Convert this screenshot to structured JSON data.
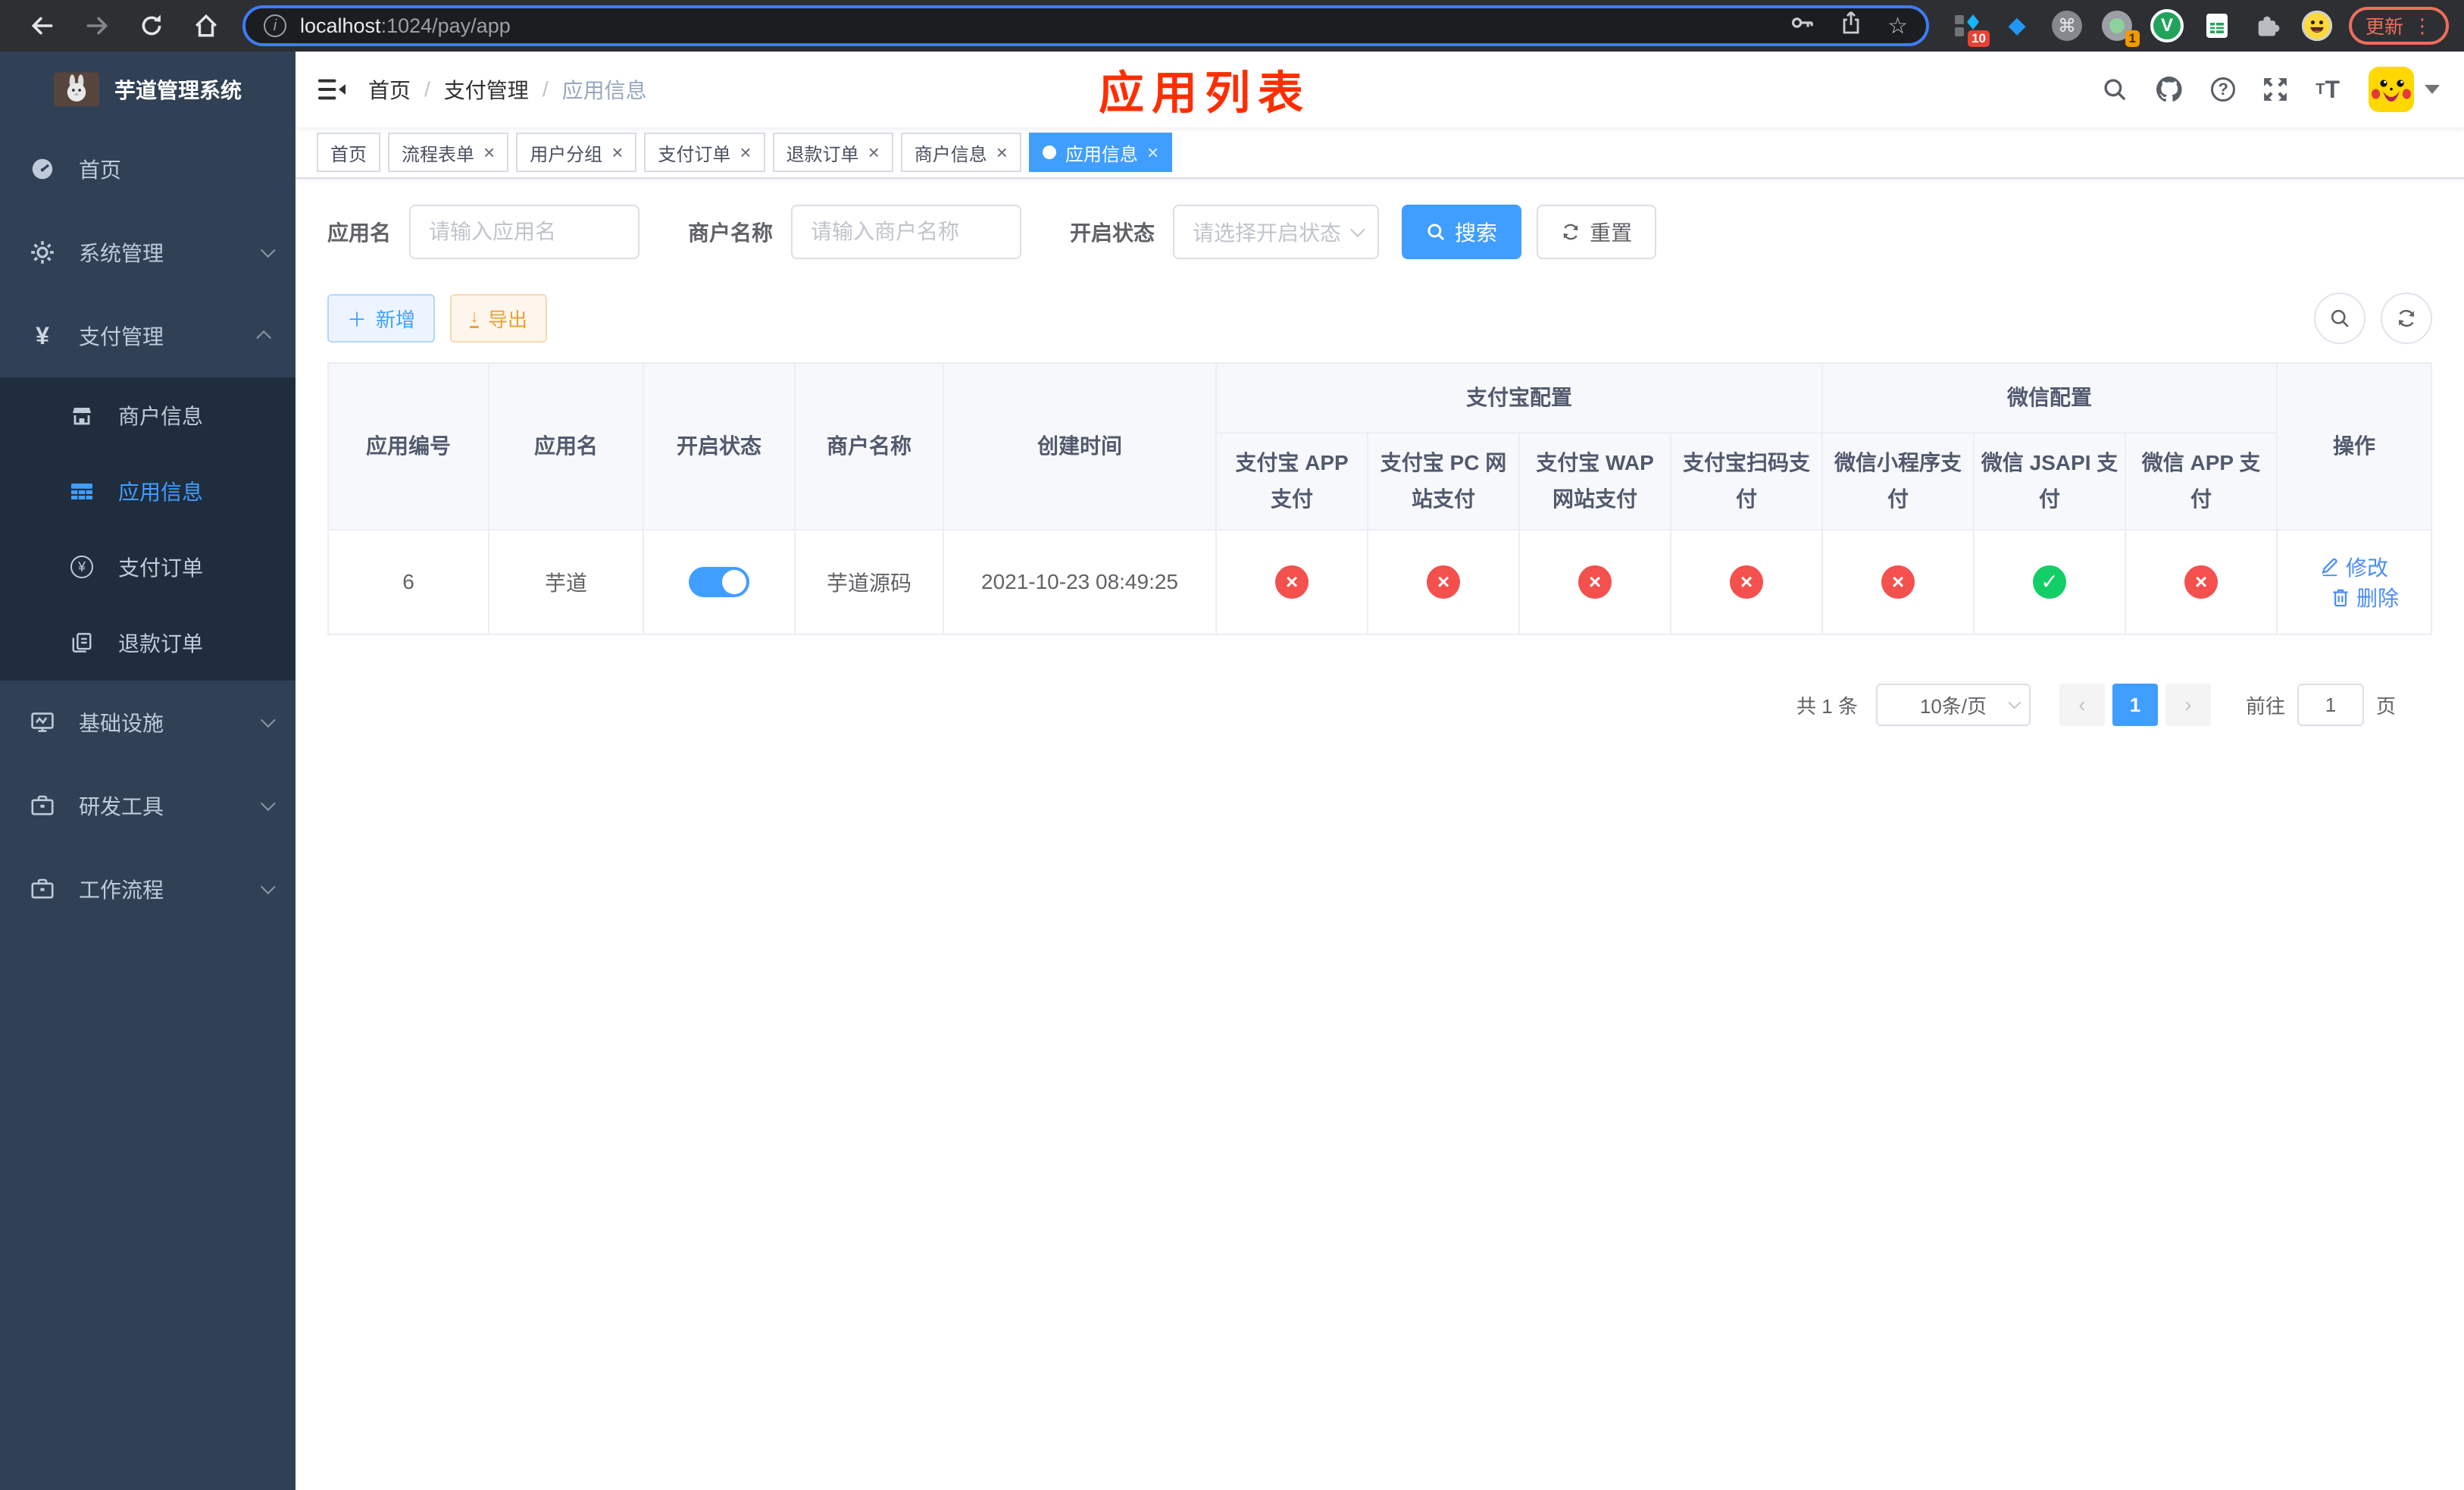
{
  "browser": {
    "url_host": "localhost",
    "url_path": ":1024/pay/app",
    "update_label": "更新",
    "ext_badge_ten": "10",
    "ext_badge_one": "1",
    "ext_v_letter": "V"
  },
  "sidebar": {
    "app_title": "芋道管理系统",
    "items": {
      "home": "首页",
      "system": "系统管理",
      "pay": "支付管理",
      "merchant": "商户信息",
      "app": "应用信息",
      "order": "支付订单",
      "refund": "退款订单",
      "infra": "基础设施",
      "devtools": "研发工具",
      "workflow": "工作流程"
    }
  },
  "navbar": {
    "breadcrumb": [
      "首页",
      "支付管理",
      "应用信息"
    ],
    "breadcrumb_separator": "/",
    "page_title": "应用列表"
  },
  "tabs": [
    {
      "label": "首页"
    },
    {
      "label": "流程表单"
    },
    {
      "label": "用户分组"
    },
    {
      "label": "支付订单"
    },
    {
      "label": "退款订单"
    },
    {
      "label": "商户信息"
    },
    {
      "label": "应用信息",
      "active": true
    }
  ],
  "filters": {
    "app_name_label": "应用名",
    "app_name_placeholder": "请输入应用名",
    "merchant_label": "商户名称",
    "merchant_placeholder": "请输入商户名称",
    "status_label": "开启状态",
    "status_placeholder": "请选择开启状态",
    "search_label": "搜索",
    "reset_label": "重置"
  },
  "toolbar": {
    "add_label": "新增",
    "export_label": "导出"
  },
  "table": {
    "columns": {
      "id": "应用编号",
      "name": "应用名",
      "status": "开启状态",
      "merchant": "商户名称",
      "created": "创建时间",
      "actions": "操作"
    },
    "groups": {
      "alipay": "支付宝配置",
      "wechat": "微信配置"
    },
    "pay_columns": [
      "支付宝 APP 支付",
      "支付宝 PC 网站支付",
      "支付宝 WAP 网站支付",
      "支付宝扫码支付",
      "微信小程序支付",
      "微信 JSAPI 支付",
      "微信 APP 支付"
    ],
    "row": {
      "id": "6",
      "name": "芋道",
      "enabled": "on",
      "merchant": "芋道源码",
      "created": "2021-10-23 08:49:25",
      "pay_status": [
        "fail",
        "fail",
        "fail",
        "fail",
        "fail",
        "ok",
        "fail"
      ],
      "edit_label": "修改",
      "delete_label": "删除"
    }
  },
  "pagination": {
    "total_text": "共 1 条",
    "page_size": "10条/页",
    "current_page": "1",
    "goto_label": "前往",
    "goto_value": "1",
    "page_unit": "页"
  },
  "colors": {
    "primary": "#409eff",
    "success": "#13ce66",
    "danger": "#f4504e",
    "warning": "#e6a23c",
    "title_red": "#ff2e00",
    "sidebar_bg": "#304156",
    "submenu_bg": "#1f2d3d"
  }
}
